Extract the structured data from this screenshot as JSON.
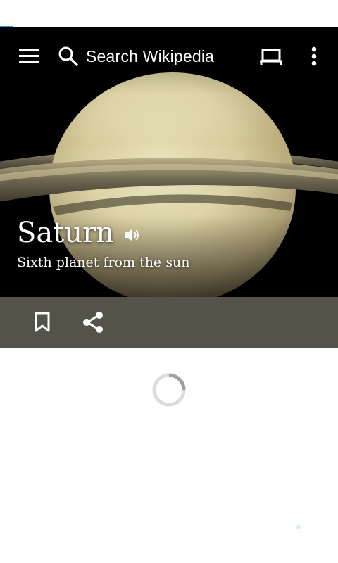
{
  "search": {
    "placeholder": "Search Wikipedia"
  },
  "article": {
    "title": "Saturn",
    "description": "Sixth planet from the sun"
  },
  "icons": {
    "menu": "menu-icon",
    "search": "search-icon",
    "reading_list": "reading-lists-icon",
    "overflow": "more-vert-icon",
    "audio": "volume-icon",
    "bookmark": "bookmark-icon",
    "share": "share-icon",
    "loading": "progress-spinner-icon"
  },
  "colors": {
    "action_bar": "#53534a",
    "hero_background": "#000000",
    "status_accent": "#2d9bd6"
  }
}
